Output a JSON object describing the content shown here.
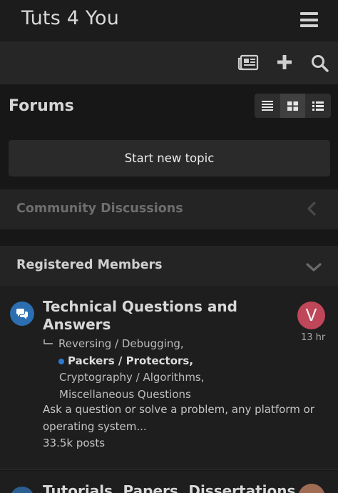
{
  "header": {
    "site_title": "Tuts 4 You",
    "menu_icon": "hamburger-menu-icon"
  },
  "toolbar": {
    "icons": [
      "newspaper-icon",
      "plus-icon",
      "search-icon"
    ]
  },
  "page": {
    "title": "Forums",
    "view_modes": [
      "table-view-icon",
      "grid-view-icon",
      "list-view-icon"
    ],
    "active_view_mode": "grid-view-icon"
  },
  "actions": {
    "start_topic_label": "Start new topic"
  },
  "categories": [
    {
      "title": "Community Discussions",
      "state": "collapsed",
      "chevron": "chevron-left-icon"
    },
    {
      "title": "Registered Members",
      "state": "expanded",
      "chevron": "chevron-down-icon"
    }
  ],
  "forums": [
    {
      "title": "Technical Questions and Answers",
      "icon": "chat-bubbles-icon",
      "subforums": [
        {
          "label": "Reversing / Debugging,",
          "unread": false
        },
        {
          "label": "Packers / Protectors,",
          "unread": true
        },
        {
          "label": "Cryptography / Algorithms,",
          "unread": false
        },
        {
          "label": "Miscellaneous Questions",
          "unread": false
        }
      ],
      "description": "Ask a question or solve a problem, any platform or operating system...",
      "posts": "33.5k posts",
      "last_poster_initial": "V",
      "last_post_time": "13 hr"
    },
    {
      "title": "Tutorials, Papers, Dissertations",
      "icon": "chat-bubbles-icon"
    }
  ],
  "colors": {
    "background": "#171717",
    "accent": "#2c6fb0",
    "avatar": "#c0465a"
  }
}
